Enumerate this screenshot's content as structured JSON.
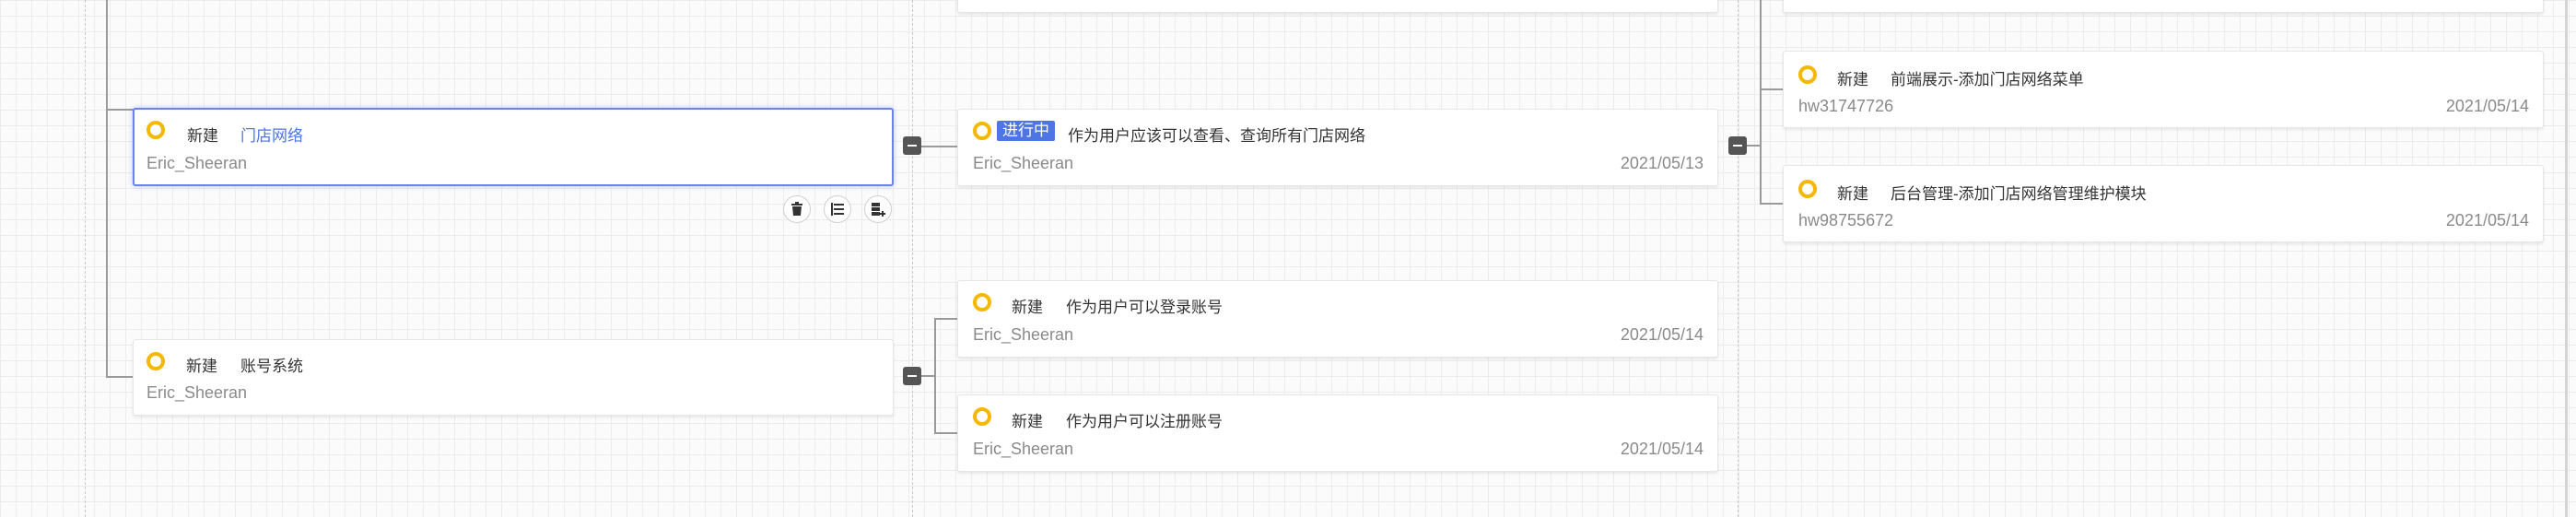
{
  "colors": {
    "accent": "#4f74e3",
    "status_ring": "#f5b800",
    "selected_border": "#6d82f0"
  },
  "column1": [
    {
      "status": "新建",
      "title": "门店网络",
      "owner": "Eric_Sheeran",
      "selected": true
    },
    {
      "status": "新建",
      "title": "账号系统",
      "owner": "Eric_Sheeran"
    }
  ],
  "column2": [
    {
      "status": "进行中",
      "title": "作为用户应该可以查看、查询所有门店网络",
      "owner": "Eric_Sheeran",
      "date": "2021/05/13"
    },
    {
      "status": "新建",
      "title": "作为用户可以登录账号",
      "owner": "Eric_Sheeran",
      "date": "2021/05/14"
    },
    {
      "status": "新建",
      "title": "作为用户可以注册账号",
      "owner": "Eric_Sheeran",
      "date": "2021/05/14"
    }
  ],
  "column3": [
    {
      "status": "新建",
      "title": "前端展示-添加门店网络菜单",
      "owner": "hw31747726",
      "date": "2021/05/14"
    },
    {
      "status": "新建",
      "title": "后台管理-添加门店网络管理维护模块",
      "owner": "hw98755672",
      "date": "2021/05/14"
    }
  ],
  "node_actions": [
    {
      "icon": "trash-icon"
    },
    {
      "icon": "list-add-icon"
    },
    {
      "icon": "database-add-icon"
    }
  ]
}
